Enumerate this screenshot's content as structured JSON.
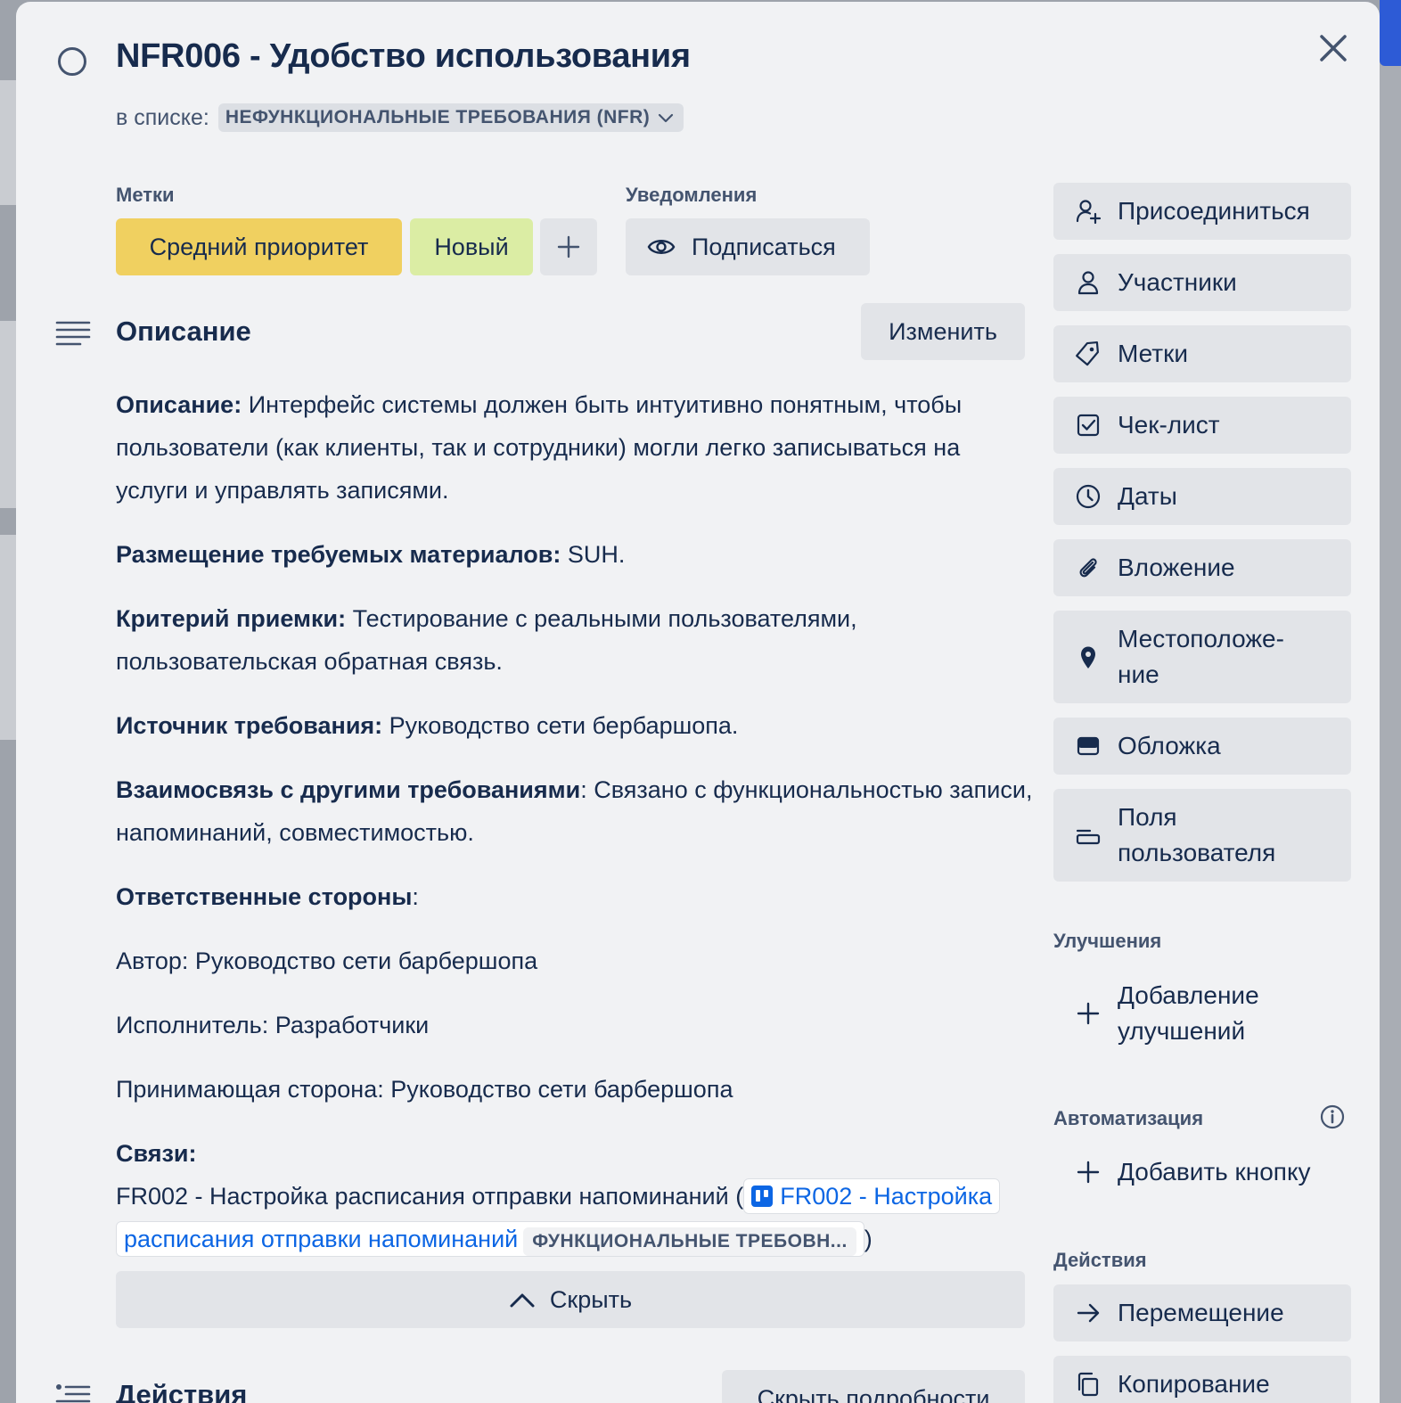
{
  "card": {
    "title": "NFR006 - Удобство использования",
    "in_list_prefix": "в списке:",
    "list_name": "НЕФУНКЦИОНАЛЬНЫЕ ТРЕБОВАНИЯ (NFR)"
  },
  "labels": {
    "heading": "Метки",
    "items": [
      {
        "text": "Средний приоритет",
        "color": "#f0d060"
      },
      {
        "text": "Новый",
        "color": "#dbeda4"
      }
    ],
    "add": "+"
  },
  "notifications": {
    "heading": "Уведомления",
    "subscribe": "Подписаться"
  },
  "description": {
    "heading": "Описание",
    "edit": "Изменить",
    "p1_bold": "Описание:",
    "p1_text": " Интерфейс системы должен быть интуитивно понятным, чтобы пользователи (как клиенты, так и сотрудники) могли легко записываться на услуги и управлять записями.",
    "p2_bold": "Размещение требуемых материалов:",
    "p2_text": " SUH.",
    "p3_bold": "Критерий приемки:",
    "p3_text": " Тестирование с реальными пользователями, пользовательская обратная связь.",
    "p4_bold": "Источник требования:",
    "p4_text": " Руководство сети бербаршопа.",
    "p5_bold": "Взаимосвязь с другими требованиями",
    "p5_text": ": Связано с функциональностью записи, напоминаний, совместимостью.",
    "p6_bold": "Ответственные стороны",
    "p6_text": ":",
    "author": "Автор: Руководство сети барбершопа",
    "executor": "Исполнитель: Разработчики",
    "receiver": "Принимающая сторона: Руководство сети барбершопа",
    "links_bold": "Связи:",
    "link_prefix": "FR002 - Настройка расписания отправки напоминаний (",
    "link_text": "FR002 - Настройка расписания отправки напоминаний",
    "link_list": "ФУНКЦИОНАЛЬНЫЕ ТРЕБОВН...",
    "link_suffix": ")",
    "hide": "Скрыть"
  },
  "activity": {
    "heading": "Действия",
    "hide_details": "Скрыть подробности"
  },
  "sidebar": {
    "buttons": [
      {
        "label": "Присоединиться",
        "icon": "user-plus-icon"
      },
      {
        "label": "Участники",
        "icon": "user-icon"
      },
      {
        "label": "Метки",
        "icon": "tag-icon"
      },
      {
        "label": "Чек-лист",
        "icon": "checkbox-icon"
      },
      {
        "label": "Даты",
        "icon": "clock-icon"
      },
      {
        "label": "Вложение",
        "icon": "paperclip-icon"
      },
      {
        "label": "Местоположе-ние",
        "icon": "location-pin-icon"
      },
      {
        "label": "Обложка",
        "icon": "cover-icon"
      },
      {
        "label": "Поля пользователя",
        "icon": "custom-fields-icon"
      }
    ],
    "improvements_heading": "Улучшения",
    "add_improvements": "Добавление улучшений",
    "automation_heading": "Автоматизация",
    "add_button": "Добавить кнопку",
    "actions_heading": "Действия",
    "move": "Перемещение",
    "copy": "Копирование"
  }
}
